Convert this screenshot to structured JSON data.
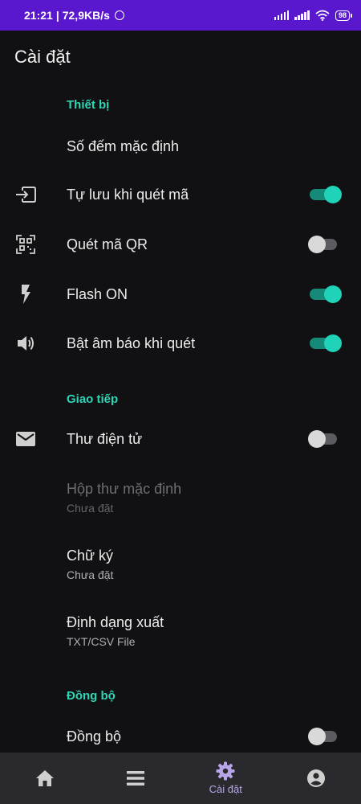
{
  "status": {
    "time": "21:21",
    "net_speed": "72,9KB/s",
    "battery": "98"
  },
  "page": {
    "title": "Cài đặt"
  },
  "sections": {
    "device": "Thiết bị",
    "communication": "Giao tiếp",
    "sync": "Đồng bộ"
  },
  "settings": {
    "default_counter": {
      "label": "Số đếm mặc định"
    },
    "auto_save": {
      "label": "Tự lưu khi quét mã",
      "on": true,
      "icon": "input-arrow-icon"
    },
    "qr_scan": {
      "label": "Quét mã QR",
      "on": false,
      "icon": "qr-code-icon"
    },
    "flash": {
      "label": "Flash ON",
      "on": true,
      "icon": "flash-icon"
    },
    "beep": {
      "label": "Bật âm báo khi quét",
      "on": true,
      "icon": "volume-icon"
    },
    "email": {
      "label": "Thư điện tử",
      "on": false,
      "icon": "mail-icon"
    },
    "default_inbox": {
      "label": "Hộp thư mặc định",
      "value": "Chưa đặt"
    },
    "signature": {
      "label": "Chữ ký",
      "value": "Chưa đặt"
    },
    "export_format": {
      "label": "Định dạng xuất",
      "value": "TXT/CSV File"
    },
    "sync": {
      "label": "Đồng bộ",
      "on": false
    }
  },
  "nav": {
    "home_icon": "home-icon",
    "list_icon": "list-icon",
    "settings_icon": "gear-icon",
    "settings_label": "Cài đặt",
    "account_icon": "account-icon"
  },
  "colors": {
    "accent": "#2fd6b6",
    "status_bar": "#5a18ce",
    "nav_active": "#b8a4e8"
  }
}
